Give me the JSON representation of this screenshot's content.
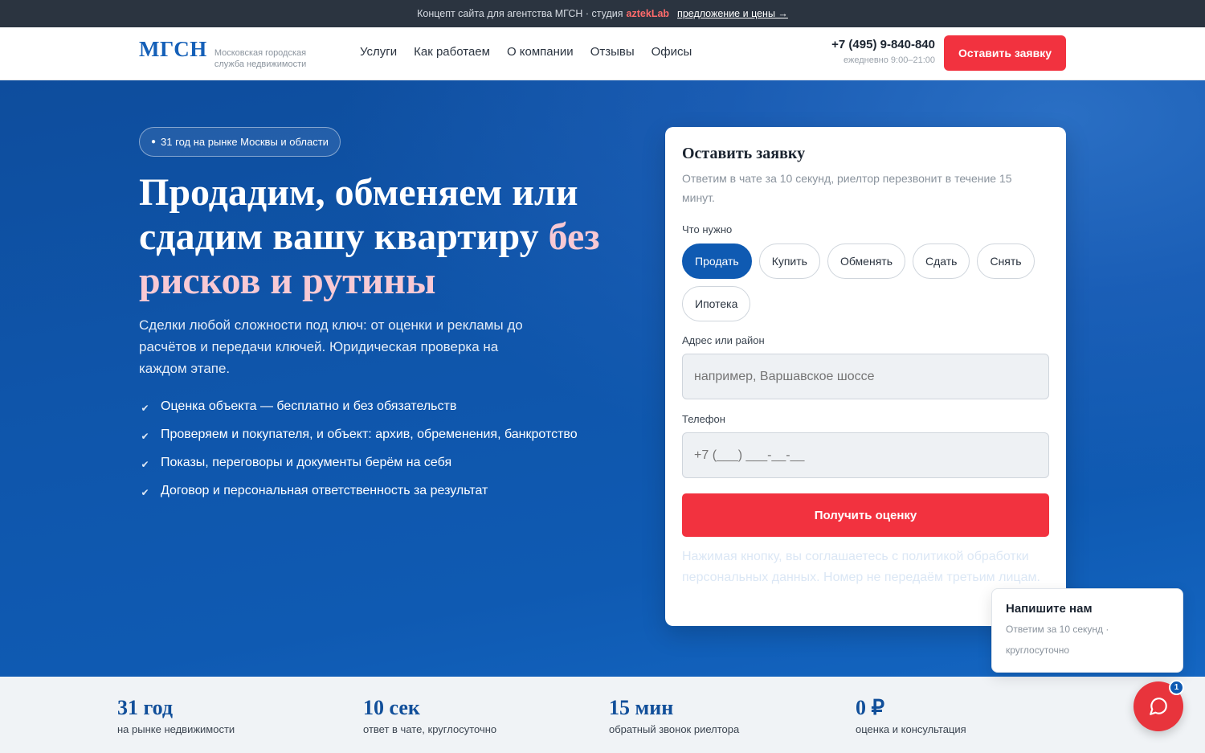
{
  "topbar": {
    "text": "Концепт сайта для агентства МГСН · студия",
    "studio": "aztekLab",
    "link": "предложение и цены →"
  },
  "header": {
    "logo": "МГСН",
    "logo_sub": "Московская городская служба недвижимости",
    "nav": [
      "Услуги",
      "Как работаем",
      "О компании",
      "Отзывы",
      "Офисы"
    ],
    "phone": "+7 (495) 9-840-840",
    "hours": "ежедневно 9:00–21:00",
    "cta": "Оставить заявку"
  },
  "hero": {
    "badge": "31 год на рынке Москвы и области",
    "title_main": "Продадим, обменяем или сдадим вашу квартиру",
    "title_accent": "без рисков и рутины",
    "lead": "Сделки любой сложности под ключ: от оценки и рекламы до расчётов и передачи ключей. Юридическая проверка на каждом этапе.",
    "checks": [
      "Оценка объекта — бесплатно и без обязательств",
      "Проверяем и покупателя, и объект: архив, обременения, банкротство",
      "Показы, переговоры и документы берём на себя",
      "Договор и персональная ответственность за результат"
    ]
  },
  "form": {
    "title": "Оставить заявку",
    "subtitle": "Ответим в чате за 10 секунд, риелтор перезвонит в течение 15 минут.",
    "need_label": "Что нужно",
    "options": [
      "Продать",
      "Купить",
      "Обменять",
      "Сдать",
      "Снять",
      "Ипотека"
    ],
    "selected": "Продать",
    "address_label": "Адрес или район",
    "address_placeholder": "например, Варшавское шоссе",
    "phone_label": "Телефон",
    "phone_placeholder": "+7 (___) ___-__-__",
    "submit": "Получить оценку",
    "legal": "Нажимая кнопку, вы соглашаетесь с политикой обработки персональных данных. Номер не передаём третьим лицам."
  },
  "stats": [
    {
      "value": "31 год",
      "label": "на рынке недвижимости"
    },
    {
      "value": "10 сек",
      "label": "ответ в чате, круглосуточно"
    },
    {
      "value": "15 мин",
      "label": "обратный звонок риелтора"
    },
    {
      "value": "0 ₽",
      "label": "оценка и консультация"
    }
  ],
  "chat": {
    "title": "Напишите нам",
    "subtitle": "Ответим за 10 секунд · круглосуточно",
    "badge": "1"
  },
  "colors": {
    "brand_blue": "#0f5ab2",
    "accent_red": "#f2323f",
    "topbar_bg": "#2b3440",
    "accent_pink": "#f8c9d4"
  }
}
